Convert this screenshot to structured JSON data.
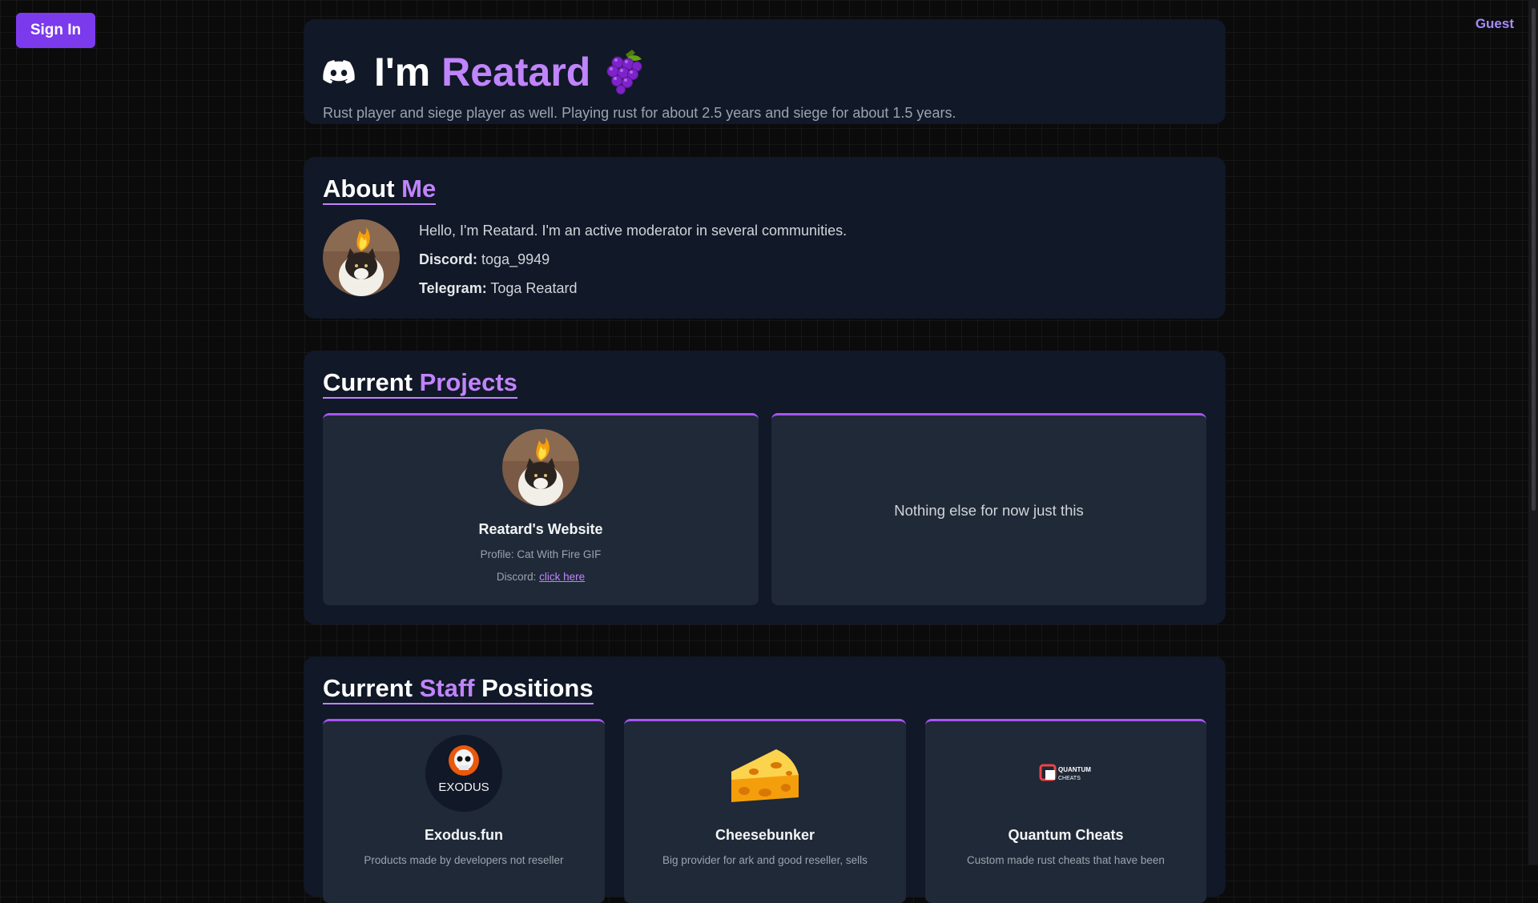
{
  "topbar": {
    "signin_label": "Sign In",
    "user_label": "Guest"
  },
  "hero": {
    "title_prefix": "I'm",
    "title_name": "Reatard",
    "subtitle": "Rust player and siege player as well. Playing rust for about 2.5 years and siege for about 1.5 years."
  },
  "about": {
    "title_a": "About",
    "title_b": "Me",
    "intro": "Hello, I'm Reatard. I'm an active moderator in several communities.",
    "discord_label": "Discord:",
    "discord_value": "toga_9949",
    "telegram_label": "Telegram:",
    "telegram_value": "Toga Reatard"
  },
  "projects": {
    "title_a": "Current",
    "title_b": "Projects",
    "card1": {
      "name": "Reatard's Website",
      "profile": "Profile: Cat With Fire GIF",
      "discord_label": "Discord:",
      "discord_link": "click here"
    },
    "card2_text": "Nothing else for now just this"
  },
  "staff": {
    "title_a": "Current",
    "title_b": "Staff",
    "title_c": "Positions",
    "items": [
      {
        "name": "Exodus.fun",
        "desc": "Products made by developers not reseller",
        "logo_text": "EXODUS"
      },
      {
        "name": "Cheesebunker",
        "desc": "Big provider for ark and good reseller, sells"
      },
      {
        "name": "Quantum Cheats",
        "desc": "Custom made rust cheats that have been",
        "logo_text_1": "QUANTUM",
        "logo_text_2": "CHEATS"
      }
    ]
  },
  "colors": {
    "accent": "#c084fc",
    "button": "#7c3aed",
    "card": "#1f2937",
    "panel": "#111827"
  }
}
